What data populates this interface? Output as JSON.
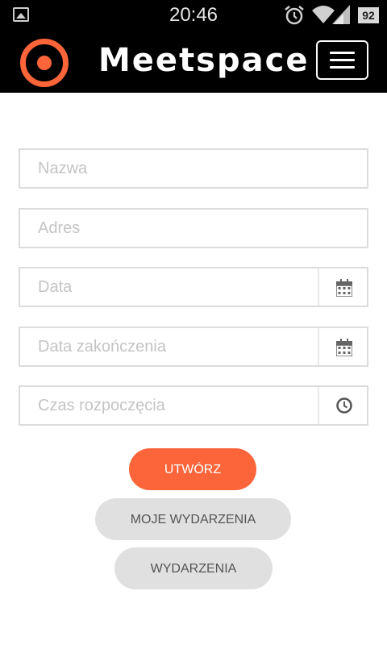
{
  "status_bar": {
    "time": "20:46",
    "battery": "92",
    "icons": [
      "photo-icon",
      "alarm-icon",
      "wifi-icon",
      "signal-icon",
      "battery-icon"
    ]
  },
  "app_bar": {
    "brand": "Meetspace",
    "logo_icon": "target-logo-icon",
    "menu_icon": "hamburger-menu-icon",
    "accent_color": "#fb6539",
    "background_color": "#000000"
  },
  "form": {
    "name_placeholder": "Nazwa",
    "address_placeholder": "Adres",
    "date_placeholder": "Data",
    "end_date_placeholder": "Data zakończenia",
    "start_time_placeholder": "Czas rozpoczęcia",
    "date_icon": "calendar-icon",
    "time_icon": "clock-icon"
  },
  "buttons": {
    "create": "UTWÓRZ",
    "my_events": "MOJE WYDARZENIA",
    "events": "WYDARZENIA",
    "primary_color": "#fb6539",
    "secondary_color": "#e0e0e0"
  }
}
